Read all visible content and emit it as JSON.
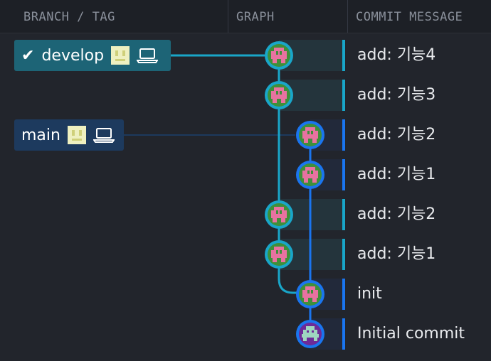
{
  "header": {
    "branch_tag": "BRANCH / TAG",
    "graph": "GRAPH",
    "commit_message": "COMMIT MESSAGE"
  },
  "branches": {
    "develop": {
      "label": "develop",
      "checked_out": true,
      "color": "#1d6476"
    },
    "main": {
      "label": "main",
      "checked_out": false,
      "color": "#1d3a5e"
    }
  },
  "colors": {
    "develop_lane": "#19a6c9",
    "main_lane": "#1a75ef",
    "avatar_green": "#3f8f3a",
    "avatar_pink": "#e872a0",
    "initial_avatar": "#6d2a98"
  },
  "commits": [
    {
      "message": "add: 기능4",
      "lane": "develop"
    },
    {
      "message": "add: 기능3",
      "lane": "develop"
    },
    {
      "message": "add: 기능2",
      "lane": "main"
    },
    {
      "message": "add: 기능1",
      "lane": "main"
    },
    {
      "message": "add: 기능2",
      "lane": "develop"
    },
    {
      "message": "add: 기능1",
      "lane": "develop"
    },
    {
      "message": "init",
      "lane": "main"
    },
    {
      "message": "Initial commit",
      "lane": "main"
    }
  ]
}
